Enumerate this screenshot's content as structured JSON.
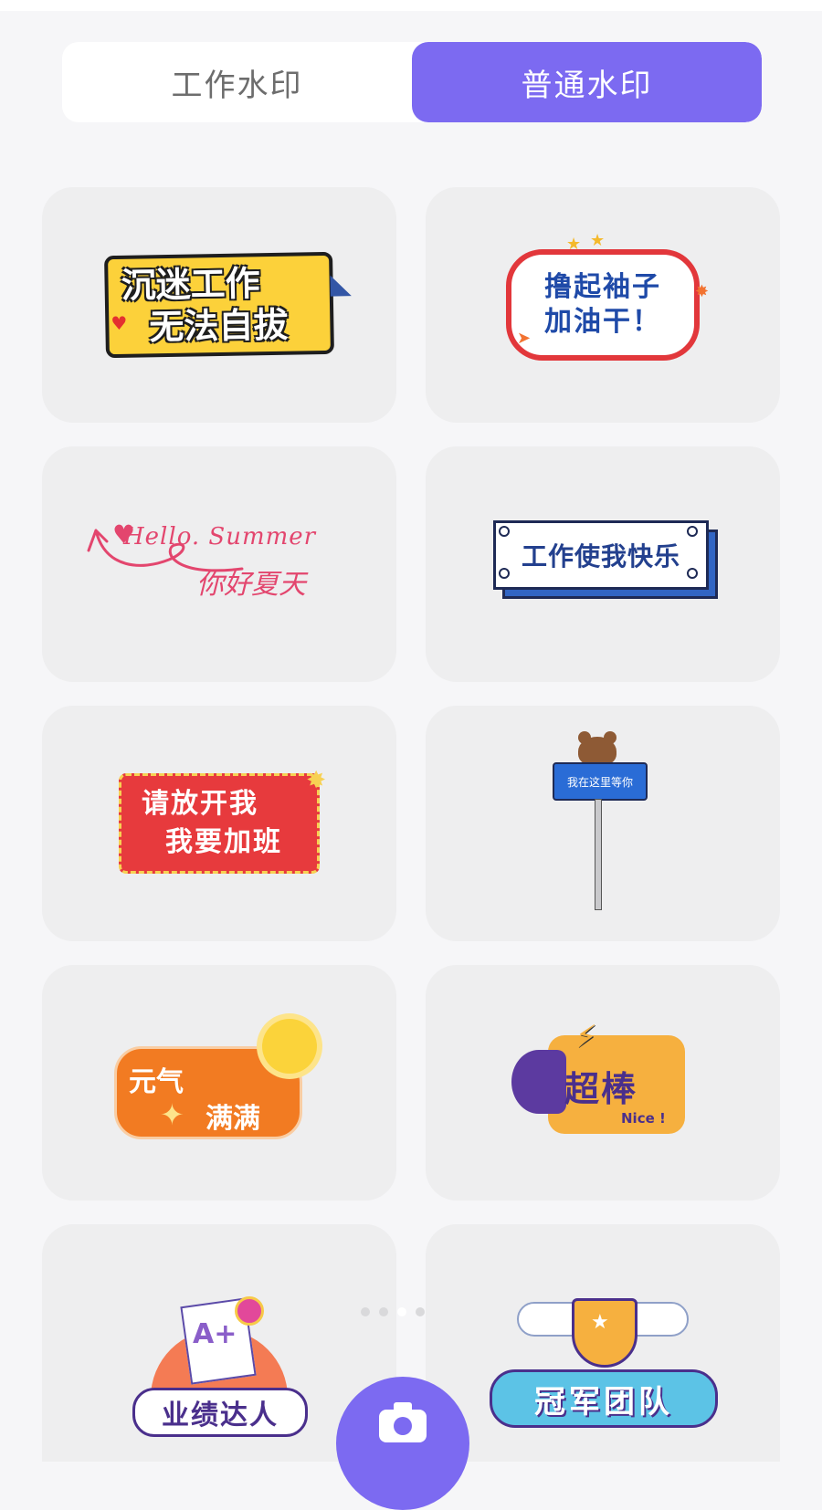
{
  "tabs": [
    {
      "label": "工作水印",
      "active": false
    },
    {
      "label": "普通水印",
      "active": true
    }
  ],
  "colors": {
    "accent": "#7c6af1",
    "card_bg": "#eeeeef",
    "page_bg": "#f6f6f8"
  },
  "stickers": [
    {
      "lines": [
        "沉迷工作",
        "无法自拔"
      ]
    },
    {
      "lines": [
        "撸起袖子",
        "加油干！"
      ]
    },
    {
      "lines": [
        "Hello. Summer",
        "你好夏天"
      ]
    },
    {
      "lines": [
        "工作使我快乐"
      ]
    },
    {
      "lines": [
        "请放开我",
        "我要加班"
      ]
    },
    {
      "lines": [
        "我在这里等你"
      ]
    },
    {
      "lines": [
        "元气",
        "满满"
      ]
    },
    {
      "lines": [
        "超棒",
        "Nice !"
      ]
    },
    {
      "lines": [
        "A+",
        "业绩达人"
      ]
    },
    {
      "lines": [
        "冠军团队"
      ]
    }
  ],
  "pager": {
    "active_index": 2,
    "count": 4
  },
  "camera_button": {
    "icon": "camera-icon"
  }
}
